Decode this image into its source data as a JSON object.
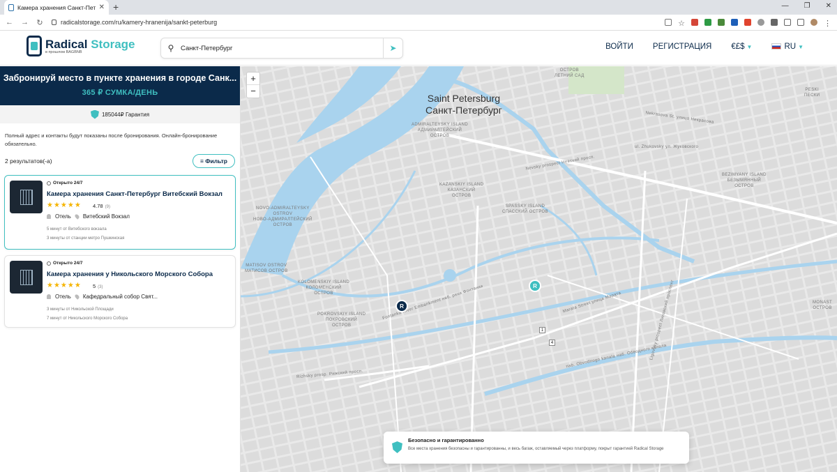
{
  "browser": {
    "tab_title": "Камера хранения Санкт-Петербург",
    "url": "radicalstorage.com/ru/kamery-hranenija/sankt-peterburg",
    "new_tab": "+",
    "close": "✕"
  },
  "header": {
    "logo_main": "Radical",
    "logo_accent": "Storage",
    "logo_sub": "в прошлом BAGBNB",
    "search_value": "Санкт-Петербург",
    "login": "ВОЙТИ",
    "register": "РЕГИСТРАЦИЯ",
    "currency": "€£$",
    "language": "RU"
  },
  "promo": {
    "title": "Забронируй место в пункте хранения в городе Санк...",
    "price": "365 ₽  СУМКА/ДЕНЬ"
  },
  "guarantee": {
    "text": "185044₽ Гарантия"
  },
  "note": "Полный адрес и контакты будут показаны после бронирования. Онлайн-бронирование обязательно.",
  "results": {
    "count": "2",
    "label": "результатов(-а)",
    "filter": "Фильтр"
  },
  "listings": [
    {
      "open": "Открыто 24/7",
      "title": "Камера хранения Санкт-Петербург Витебский Вокзал",
      "stars": "★★★★★",
      "rating": "4.78",
      "reviews": "(9)",
      "type": "Отель",
      "place": "Витебский Вокзал",
      "dist1": "5 минут от Витебского вокзала",
      "dist2": "3 минуты от станции метро Пушкинская"
    },
    {
      "open": "Открыто 24/7",
      "title": "Камера хранения у Никольского Морского Собора",
      "stars": "★★★★★",
      "rating": "5",
      "reviews": "(3)",
      "type": "Отель",
      "place": "Кафедральный собор Свят...",
      "dist1": "3 минуты от Никольской Площади",
      "dist2": "7 минут от Никольского Морского Собора"
    }
  ],
  "map": {
    "zoom_in": "+",
    "zoom_out": "−",
    "city_en": "Saint Petersburg",
    "city_ru": "Санкт-Петербург",
    "labels": {
      "admiralteysky": "ADMIRALTEYSKY ISLAND\nАДМИРАЛТЕЙСКИЙ\nОСТРОВ",
      "kazansky": "KAZANSKIY ISLAND\nКАЗАНСКИЙ\nОСТРОВ",
      "spassky": "SPASSKY ISLAND\nСПАССКИЙ ОСТРОВ",
      "novoadm": "NOVO-ADMIRALTEYSKY\nOSTROV\nНОВО-АДМИРАЛТЕЙСКИЙ\nОСТРОВ",
      "matisov": "MATISOV OSTROV\nМАТИСОВ ОСТРОВ",
      "kolomensky": "KOLOMENSKIY ISLAND\nКОЛОМЕНСКИЙ\nОСТРОВ",
      "pokrovsky": "POKROVSKIY ISLAND\nПОКРОВСКИЙ\nОСТРОВ",
      "bezymyany": "BEZIMYANY ISLAND\nБЕЗЫМЯННЫЙ\nОСТРОВ",
      "letny": "ОСТРОВ\nЛЕТНИЙ САД",
      "peski": "PESKI\nПЕСКИ",
      "monast": "MONAST\nОСТРОВ",
      "nevsky": "Nevsky prospect Невский просп.",
      "nekrasova": "Nekrasova St. улица Некрасова",
      "zhukovsky": "ul. Zhukovsky ул. Жуковского",
      "fontanka": "Fontanka River Embankment наб. реки Фонтанки",
      "rizhsky": "Rizhsky prosp. Рижский просп.",
      "obvodny": "nab. Obvodnogo kanala наб. Обводного канала",
      "marata": "Marata Street улица Марата",
      "ligovsky": "Ligovsky prospect Лиговский проспект"
    },
    "markers": {
      "one": "1",
      "four": "4"
    }
  },
  "toast": {
    "title": "Безопасно и гарантированно",
    "desc": "Все места хранения безопасны и гарантированны, и весь багаж, оставляемый через платформу, покрыт гарантией Radical Storage"
  },
  "colors": {
    "navy": "#0b2a4a",
    "teal": "#3fbfc0",
    "water": "#a9d3ee"
  }
}
